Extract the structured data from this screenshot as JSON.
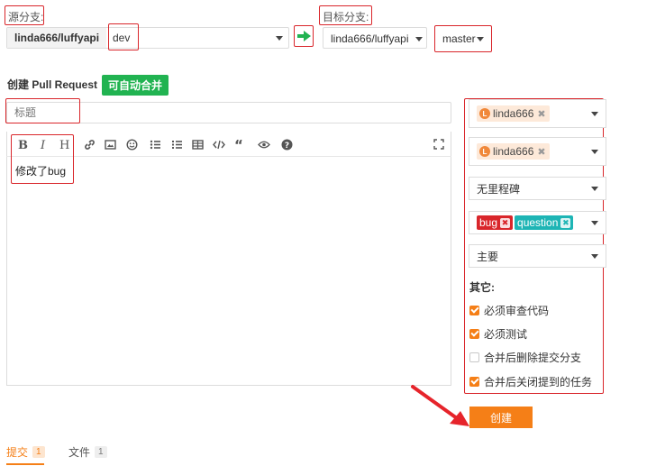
{
  "source": {
    "label": "源分支:",
    "repo": "linda666/luffyapi",
    "branch": "dev"
  },
  "target": {
    "label": "目标分支:",
    "repo": "linda666/luffyapi",
    "branch": "master"
  },
  "pr": {
    "heading": "创建 Pull Request",
    "auto_merge_badge": "可自动合并",
    "title_placeholder": "标题",
    "body_text": "修改了bug"
  },
  "sidebar": {
    "reviewer": "linda666",
    "tester": "linda666",
    "milestone": "无里程碑",
    "labels": [
      {
        "text": "bug",
        "color": "#d9262b"
      },
      {
        "text": "question",
        "color": "#1eb5b5"
      }
    ],
    "priority": "主要",
    "other_label": "其它:",
    "options": [
      {
        "label": "必须审查代码",
        "checked": true
      },
      {
        "label": "必须测试",
        "checked": true
      },
      {
        "label": "合并后删除提交分支",
        "checked": false
      },
      {
        "label": "合并后关闭提到的任务",
        "checked": true
      }
    ]
  },
  "create_button": "创建",
  "tabs": [
    {
      "label": "提交",
      "count": "1",
      "active": true
    },
    {
      "label": "文件",
      "count": "1",
      "active": false
    }
  ],
  "colors": {
    "accent": "#f57f17",
    "highlight": "#d9262b",
    "merge_green": "#21b351",
    "arrow_red": "#e6242b"
  }
}
